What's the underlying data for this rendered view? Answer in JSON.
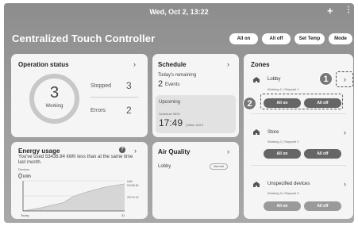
{
  "statusbar": {
    "datetime": "Wed, Oct 2, 13:22",
    "add_icon": "plus-icon",
    "menu_icon": "kebab-icon"
  },
  "header": {
    "title": "Centralized Touch Controller",
    "buttons": {
      "all_on": "All on",
      "all_off": "All off",
      "set_temp": "Set Temp",
      "mode": "Mode"
    }
  },
  "operation_status": {
    "title": "Operation status",
    "working_count": "3",
    "working_label": "Working",
    "stopped_label": "Stopped",
    "stopped_count": "3",
    "errors_label": "Errors",
    "errors_count": "2"
  },
  "schedule": {
    "title": "Schedule",
    "remaining_label": "Today's remaining",
    "remaining_count": "2",
    "remaining_unit": "Events",
    "upcoming_label": "Upcoming",
    "upcoming_name": "Schedule 0625",
    "upcoming_time": "17:49",
    "upcoming_date": "| Wed, Oct 2"
  },
  "energy": {
    "title": "Energy usage",
    "message": "You've used 53438.84 kWh less than at the same time last month.",
    "devices_label": "Devices",
    "value": "0",
    "unit": "kWh",
    "y_max_label": "kWh\n53438.84",
    "y_mid_label": "26719.42",
    "x_start": "Today",
    "x_end": "31",
    "help_icon": "help-icon"
  },
  "chart_data": {
    "type": "area",
    "x": [
      1,
      6,
      13,
      16,
      20,
      25,
      31
    ],
    "series": [
      {
        "values": [
          0,
          5000,
          15000,
          26000,
          34000,
          42000,
          48000
        ]
      }
    ],
    "ylim": [
      0,
      53438.84
    ]
  },
  "air_quality": {
    "title": "Air Quality",
    "location": "Lobby",
    "status": "Normal"
  },
  "zones": {
    "title": "Zones",
    "items": [
      {
        "name": "Lobby",
        "working_label": "Working",
        "working": "1",
        "stopped_label": "Stopped",
        "stopped": "1",
        "on_label": "All on",
        "off_label": "All off"
      },
      {
        "name": "Store",
        "working_label": "Working",
        "working": "2",
        "stopped_label": "Stopped",
        "stopped": "2",
        "on_label": "All on",
        "off_label": "All off"
      },
      {
        "name": "Unspecified devices",
        "working_label": "Working",
        "working": "0",
        "stopped_label": "Stopped",
        "stopped": "0",
        "on_label": "All on",
        "off_label": "All off"
      }
    ]
  },
  "callouts": {
    "one": "1",
    "two": "2"
  },
  "colors": {
    "background": "#9a9a9a",
    "card": "#f5f5f5",
    "pill_dark": "#666666",
    "accent_text": "#222222"
  }
}
